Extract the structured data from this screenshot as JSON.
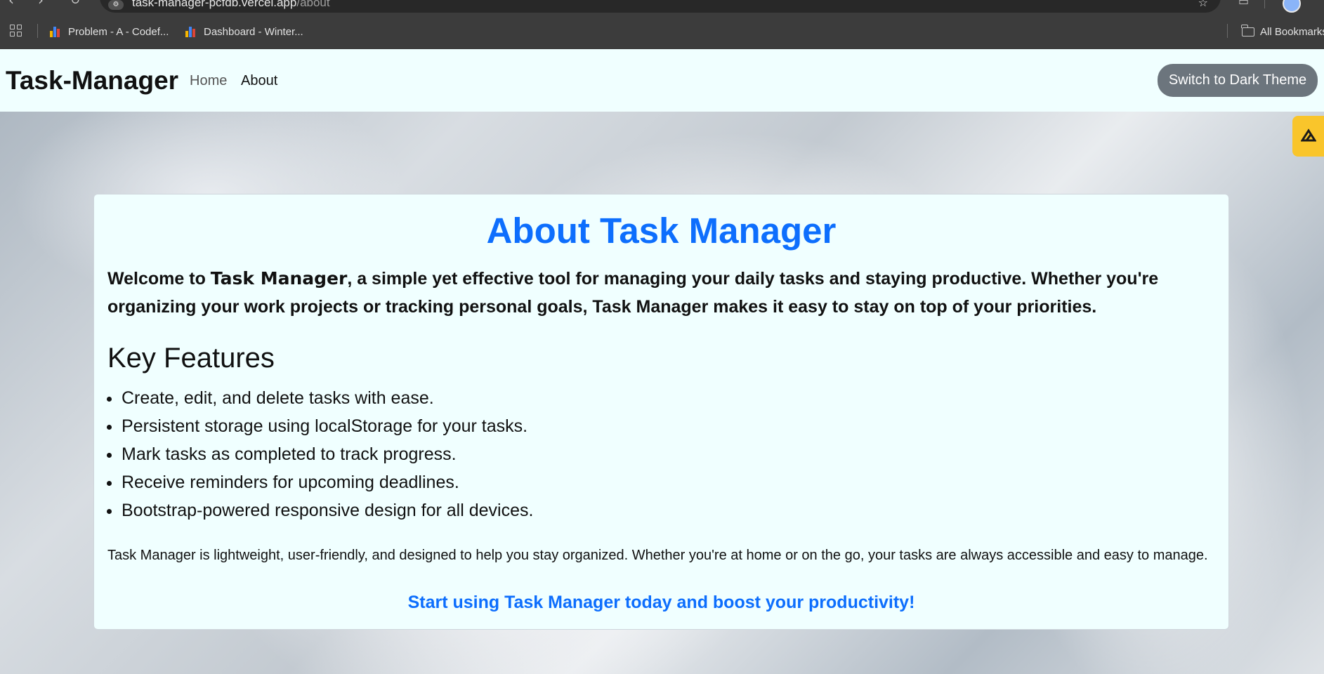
{
  "browser": {
    "url_host": "task-manager-pcfdb.vercel.app",
    "url_path": "/about",
    "site_info_icon": "tune-icon",
    "bookmarks": [
      {
        "label": "Problem - A - Codef...",
        "icon": "bar-chart-favicon"
      },
      {
        "label": "Dashboard - Winter...",
        "icon": "bar-chart-favicon"
      }
    ],
    "all_bookmarks_label": "All Bookmarks"
  },
  "navbar": {
    "brand": "Task-Manager",
    "links": [
      {
        "label": "Home",
        "active": false
      },
      {
        "label": "About",
        "active": true
      }
    ],
    "theme_button": "Switch to Dark Theme"
  },
  "about": {
    "title": "About Task Manager",
    "intro_prefix": "Welcome to ",
    "intro_brand": "Task Manager",
    "intro_suffix": ", a simple yet effective tool for managing your daily tasks and staying productive. Whether you're organizing your work projects or tracking personal goals, Task Manager makes it easy to stay on top of your priorities.",
    "features_heading": "Key Features",
    "features": [
      "Create, edit, and delete tasks with ease.",
      "Persistent storage using localStorage for your tasks.",
      "Mark tasks as completed to track progress.",
      "Receive reminders for upcoming deadlines.",
      "Bootstrap-powered responsive design for all devices."
    ],
    "summary": "Task Manager is lightweight, user-friendly, and designed to help you stay organized. Whether you're at home or on the go, your tasks are always accessible and easy to manage.",
    "cta": "Start using Task Manager today and boost your productivity!"
  },
  "colors": {
    "accent": "#0d6efd",
    "navbar_bg": "#f0ffff",
    "card_bg": "#f0ffff",
    "theme_button_bg": "#6c757d",
    "extension_tab": "#f9c52b"
  }
}
